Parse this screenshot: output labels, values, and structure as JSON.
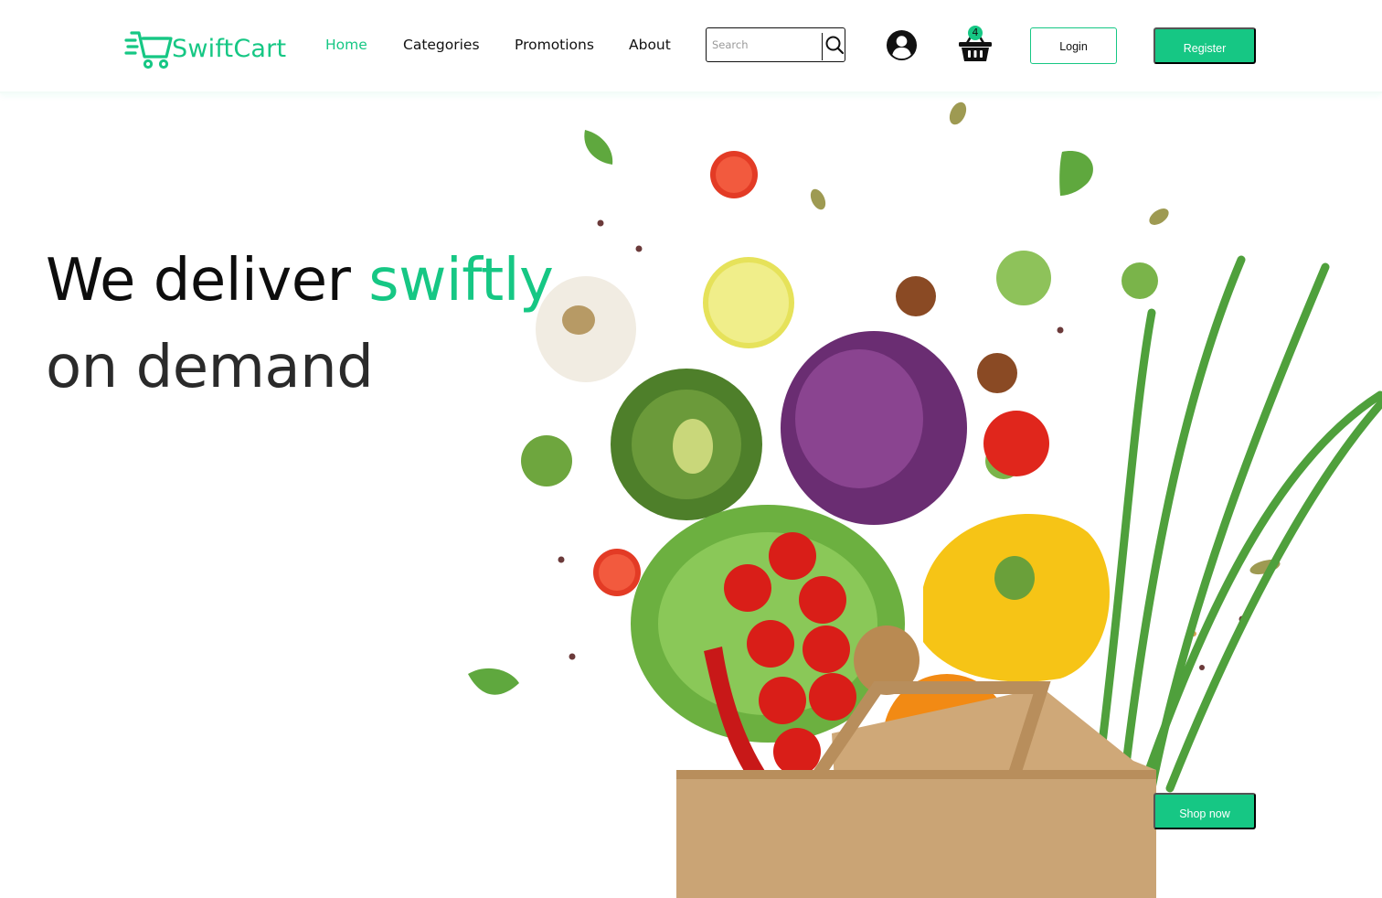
{
  "brand": {
    "name": "SwiftCart",
    "accent_color": "#16c784",
    "logo_icon": "shopping-cart-speed-icon"
  },
  "nav": {
    "home": "Home",
    "categories": "Categories",
    "promotions": "Promotions",
    "about": "About",
    "active": "Home"
  },
  "search": {
    "placeholder": "Search",
    "value": "",
    "icon": "search-icon"
  },
  "account": {
    "icon": "user-avatar-icon"
  },
  "cart": {
    "icon": "basket-icon",
    "count": "4"
  },
  "auth": {
    "login_label": "Login",
    "register_label": "Register"
  },
  "hero": {
    "headline_part1": "We deliver ",
    "headline_accent": "swiftly",
    "headline_line2": "on demand",
    "cta_label": "Shop now",
    "image": "grocery-bag-vegetables-illustration"
  }
}
